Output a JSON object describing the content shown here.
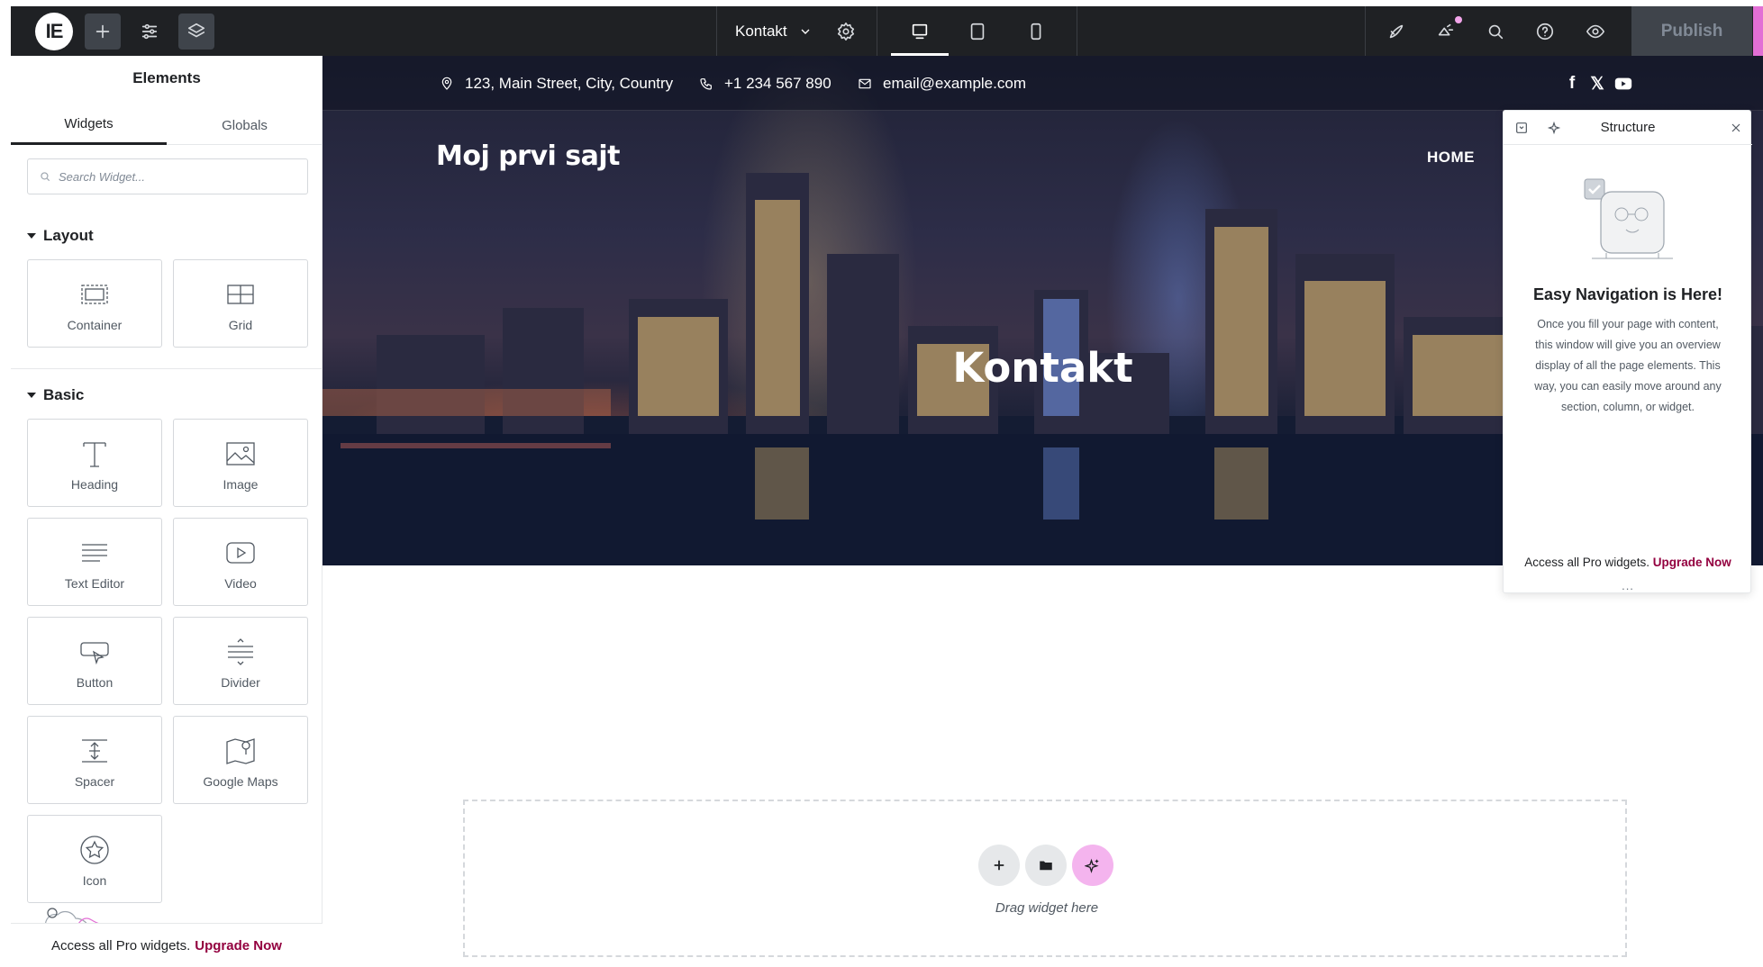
{
  "topbar": {
    "page_name": "Kontakt",
    "publish_label": "Publish",
    "icons": [
      "elementor-logo-icon",
      "add-icon",
      "settings-sliders-icon",
      "layers-icon",
      "chevron-down-icon",
      "gear-icon",
      "desktop-icon",
      "tablet-icon",
      "mobile-icon",
      "rocket-icon",
      "notifications-icon",
      "search-icon",
      "help-icon",
      "preview-eye-icon"
    ]
  },
  "panel": {
    "title": "Elements",
    "tabs": [
      {
        "label": "Widgets",
        "active": true
      },
      {
        "label": "Globals",
        "active": false
      }
    ],
    "search_placeholder": "Search Widget...",
    "categories": {
      "layout": {
        "label": "Layout",
        "widgets": [
          {
            "label": "Container",
            "icon": "container-icon"
          },
          {
            "label": "Grid",
            "icon": "grid-icon"
          }
        ]
      },
      "basic": {
        "label": "Basic",
        "widgets": [
          {
            "label": "Heading",
            "icon": "heading-icon"
          },
          {
            "label": "Image",
            "icon": "image-icon"
          },
          {
            "label": "Text Editor",
            "icon": "text-editor-icon"
          },
          {
            "label": "Video",
            "icon": "video-icon"
          },
          {
            "label": "Button",
            "icon": "button-icon"
          },
          {
            "label": "Divider",
            "icon": "divider-icon"
          },
          {
            "label": "Spacer",
            "icon": "spacer-icon"
          },
          {
            "label": "Google Maps",
            "icon": "google-maps-icon"
          },
          {
            "label": "Icon",
            "icon": "star-icon"
          }
        ]
      }
    },
    "footer_text": "Access all Pro widgets.",
    "footer_link": "Upgrade Now"
  },
  "site": {
    "address": "123, Main Street, City, Country",
    "phone": "+1 234 567 890",
    "email": "email@example.com",
    "social": [
      "facebook-icon",
      "x-icon",
      "youtube-icon"
    ],
    "site_title": "Moj prvi sajt",
    "nav_home": "HOME",
    "hero_title": "Kontakt"
  },
  "structure": {
    "title": "Structure",
    "heading": "Easy Navigation is Here!",
    "body": "Once you fill your page with content, this window will give you an overview display of all the page elements. This way, you can easily move around any section, column, or widget.",
    "footer_text": "Access all Pro widgets.",
    "footer_link": "Upgrade Now",
    "dots": "..."
  },
  "dropzone": {
    "text": "Drag widget here",
    "buttons": [
      "add-section-icon",
      "templates-folder-icon",
      "ai-sparkle-icon"
    ]
  },
  "colors": {
    "topbar": "#1f2124",
    "publish_bg": "#3f444b",
    "accent_pink": "#e26fd5",
    "upgrade_link": "#93003f"
  }
}
